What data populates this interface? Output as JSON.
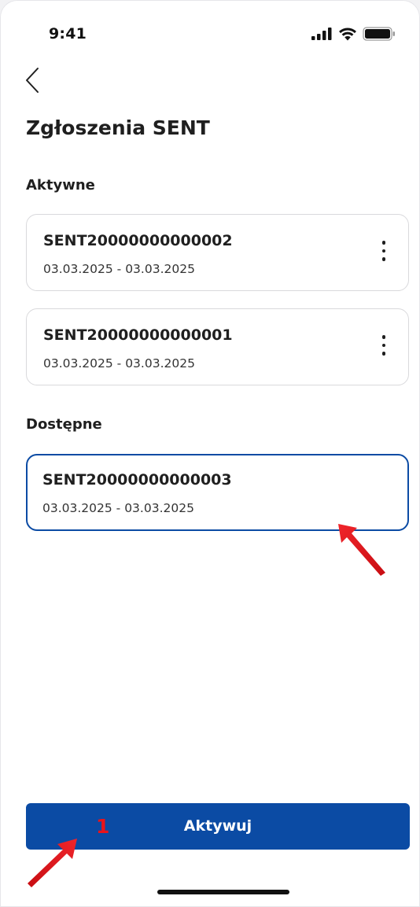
{
  "status_bar": {
    "time": "9:41",
    "icons": [
      "signal-icon",
      "wifi-icon",
      "battery-icon"
    ]
  },
  "header": {
    "back_icon": "chevron-left-icon",
    "title": "Zgłoszenia SENT"
  },
  "sections": {
    "active": {
      "title": "Aktywne",
      "items": [
        {
          "name": "SENT20000000000002",
          "date_range": "03.03.2025 - 03.03.2025",
          "menu_icon": "more-vertical-icon"
        },
        {
          "name": "SENT20000000000001",
          "date_range": "03.03.2025 - 03.03.2025",
          "menu_icon": "more-vertical-icon"
        }
      ]
    },
    "available": {
      "title": "Dostępne",
      "items": [
        {
          "name": "SENT20000000000003",
          "date_range": "03.03.2025 - 03.03.2025",
          "selected": true
        }
      ]
    }
  },
  "annotation": {
    "step_number": "1",
    "color": "#e8141b"
  },
  "footer": {
    "primary_button_label": "Aktywuj"
  },
  "colors": {
    "accent": "#0b4ba4",
    "text": "#1f1f1f",
    "card_border": "#d9d9dc"
  }
}
